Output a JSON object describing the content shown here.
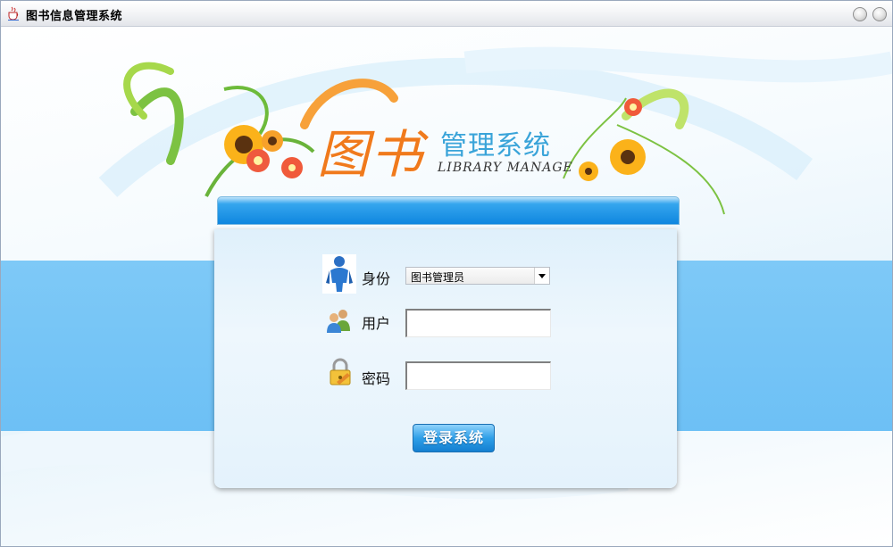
{
  "window": {
    "title": "图书信息管理系统",
    "app_icon": "java-cup-icon",
    "buttons": [
      "minimize-button",
      "maximize-button"
    ]
  },
  "banner": {
    "title_big": "图书",
    "title_small": "管理系统",
    "title_en": "LIBRARY MANAGE"
  },
  "form": {
    "role": {
      "label": "身份",
      "icon": "person-icon",
      "selected": "图书管理员"
    },
    "username": {
      "label": "用户",
      "icon": "users-icon",
      "value": ""
    },
    "password": {
      "label": "密码",
      "icon": "lock-icon",
      "value": ""
    },
    "login_label": "登录系统"
  },
  "colors": {
    "band": "#6dc0f5",
    "header": "#1a8ce2",
    "logo_orange": "#f07a1c",
    "logo_blue": "#3aa4d9",
    "button": "#2f9fe8"
  }
}
